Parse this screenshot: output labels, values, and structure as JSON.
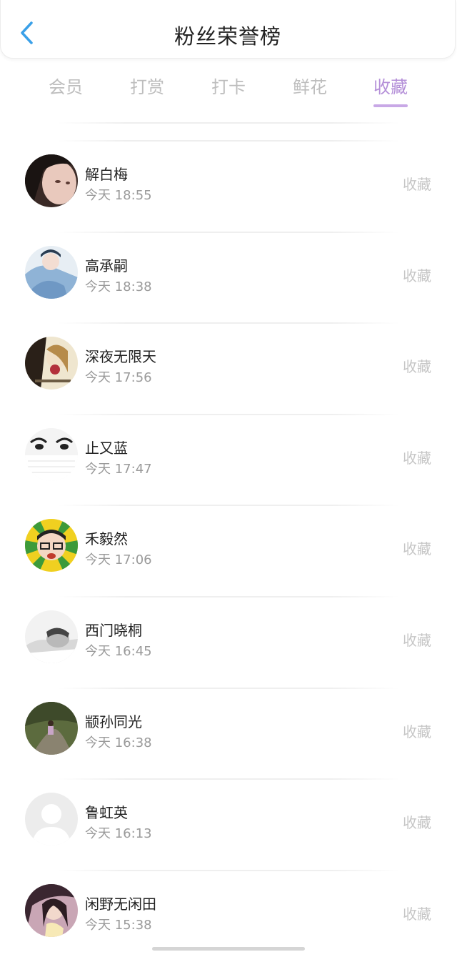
{
  "header": {
    "title": "粉丝荣誉榜",
    "back_icon": "chevron-left-icon",
    "accent_color": "#3aa0e8"
  },
  "tabs": [
    {
      "label": "会员",
      "active": false
    },
    {
      "label": "打赏",
      "active": false
    },
    {
      "label": "打卡",
      "active": false
    },
    {
      "label": "鲜花",
      "active": false
    },
    {
      "label": "收藏",
      "active": true
    }
  ],
  "active_color": "#b48fd8",
  "list": [
    {
      "name": "解白梅",
      "time": "今天 18:55",
      "action": "收藏",
      "avatar": "avatar-photo-icon"
    },
    {
      "name": "高承嗣",
      "time": "今天 18:38",
      "action": "收藏",
      "avatar": "avatar-photo-icon"
    },
    {
      "name": "深夜无限天",
      "time": "今天 17:56",
      "action": "收藏",
      "avatar": "avatar-photo-icon"
    },
    {
      "name": "止又蓝",
      "time": "今天 17:47",
      "action": "收藏",
      "avatar": "avatar-photo-icon"
    },
    {
      "name": "禾毅然",
      "time": "今天 17:06",
      "action": "收藏",
      "avatar": "avatar-cartoon-icon"
    },
    {
      "name": "西门晓桐",
      "time": "今天 16:45",
      "action": "收藏",
      "avatar": "avatar-photo-icon"
    },
    {
      "name": "颛孙同光",
      "time": "今天 16:38",
      "action": "收藏",
      "avatar": "avatar-photo-icon"
    },
    {
      "name": "鲁虹英",
      "time": "今天 16:13",
      "action": "收藏",
      "avatar": "avatar-default-icon"
    },
    {
      "name": "闲野无闲田",
      "time": "今天 15:38",
      "action": "收藏",
      "avatar": "avatar-photo-icon"
    }
  ]
}
